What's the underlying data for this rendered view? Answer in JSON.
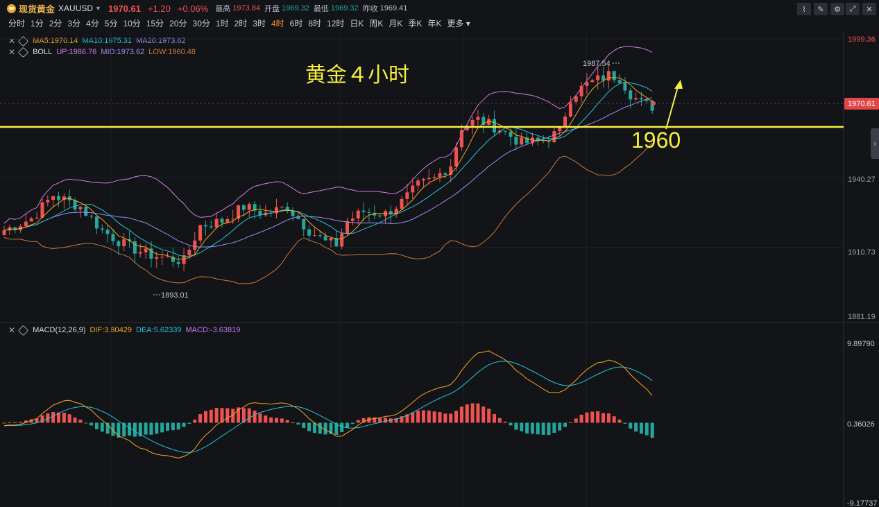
{
  "header": {
    "title": "现货黄金",
    "symbol": "XAUUSD",
    "price": "1970.61",
    "change": "+1.20",
    "change_pct": "+0.06%",
    "high_label": "最高",
    "high": "1973.84",
    "open_label": "开盘",
    "open": "1969.32",
    "low_label": "最低",
    "low": "1969.32",
    "prev_close_label": "昨收",
    "prev_close": "1969.41"
  },
  "timeframes": [
    "分时",
    "1分",
    "2分",
    "3分",
    "4分",
    "5分",
    "10分",
    "15分",
    "20分",
    "30分",
    "1时",
    "2时",
    "3时",
    "4时",
    "6时",
    "8时",
    "12时",
    "日K",
    "周K",
    "月K",
    "季K",
    "年K",
    "更多"
  ],
  "active_timeframe": "4时",
  "indicators": {
    "ma": {
      "name": "MA5:1970.14",
      "ma10": "MA10:1975.31",
      "ma20": "MA20:1973.62"
    },
    "boll": {
      "name": "BOLL",
      "up": "UP:1986.76",
      "mid": "MID:1973.62",
      "low": "LOW:1960.48"
    },
    "macd": {
      "name": "MACD(12,26,9)",
      "dif": "DIF:3.80429",
      "dea": "DEA:5.62339",
      "macd": "MACD:-3.63819"
    }
  },
  "annotations": {
    "title": "黄金４小时",
    "level": "1960",
    "high_marker": "1987.54",
    "low_marker": "1893.01"
  },
  "price_axis": {
    "ticks": [
      "1999.36",
      "1940.27",
      "1910.73",
      "1881.19"
    ],
    "current": "1970.61"
  },
  "macd_axis": {
    "ticks": [
      "9.89790",
      "0.36026",
      "-9.17737"
    ]
  },
  "colors": {
    "up": "#ef5350",
    "down": "#26a69a",
    "ma5": "#f5a623",
    "ma10": "#26c6da",
    "ma20": "#9b8cf2",
    "boll_up": "#d77ce6",
    "boll_low": "#c97a3c",
    "level": "#f7ef3d"
  }
}
